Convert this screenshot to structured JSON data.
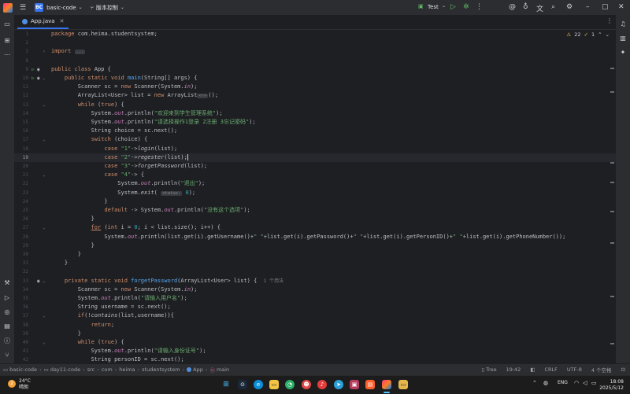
{
  "titlebar": {
    "project_badge": "BC",
    "project_name": "basic-code",
    "vcs": "版本控制",
    "run_config": "Test"
  },
  "tab": {
    "file_name": "App.java"
  },
  "inspections": {
    "warning_count": "22",
    "hint_count": "1"
  },
  "code": {
    "package_name": "com.heima.studentsystem",
    "import_fold": "...",
    "usage_hint": "1 个用法",
    "param_status": "status:",
    "generic_fold": "<~>",
    "str_welcome": "\"欢迎来到学生管理系统\"",
    "str_menu": "\"请选择操作1登录 2注册 3忘记密码\"",
    "str_case1": "\"1\"",
    "str_case2": "\"2\"",
    "str_case3": "\"3\"",
    "str_case4": "\"4\"",
    "str_exit": "\"退出\"",
    "str_default": "\"没有这个选项\"",
    "str_sep": "\" \"",
    "str_username": "\"请输入用户名\"",
    "str_id": "\"请输入身份证号\"",
    "username_var": "username",
    "personID_var": "personID"
  },
  "breadcrumbs": [
    "basic-code",
    "day11-code",
    "src",
    "com",
    "heima",
    "studentsystem",
    "App",
    "main"
  ],
  "status": {
    "tree": "Tree",
    "position": "19:42",
    "line_sep": "CRLF",
    "encoding": "UTF-8",
    "indent": "4 个空格"
  },
  "taskbar": {
    "temperature": "24°C",
    "weather": "晴朗",
    "lang": "ENG",
    "time": "18:08",
    "date": "2025/5/12"
  }
}
